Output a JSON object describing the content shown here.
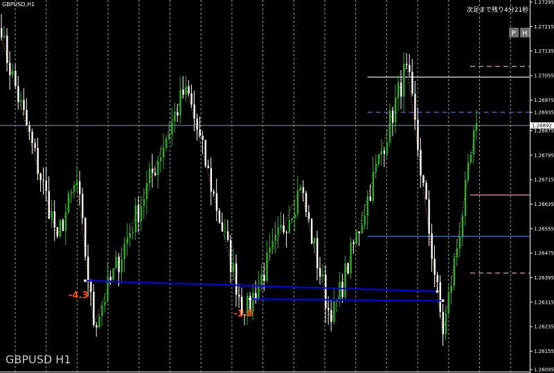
{
  "symbol_label": "GBPUSD,H1",
  "watermark": "GBPUSD H1",
  "timer_text": "次足まで残り4分21秒",
  "buttons": [
    {
      "label": "P"
    },
    {
      "label": "H"
    }
  ],
  "chart_data": {
    "type": "candlestick",
    "title": "",
    "ylim": [
      1.26095,
      1.27295
    ],
    "y_ticks": [
      "1.27295",
      "1.27215",
      "1.27135",
      "1.27055",
      "1.26975",
      "1.26935",
      "1.26875",
      "1.26795",
      "1.26715",
      "1.26635",
      "1.26555",
      "1.26475",
      "1.26395",
      "1.26315",
      "1.26235",
      "1.26155",
      "1.26095"
    ],
    "current_price": 1.26892,
    "current_price_label": "1.26892",
    "colors": {
      "bull": "#22b222",
      "bear": "#ffffff",
      "zigzag": "#b8691e",
      "trendline": "#0000ff",
      "grid": "#b0b0b0"
    },
    "zigzag": [
      {
        "i": 0,
        "p": 1.2718
      },
      {
        "i": 20,
        "p": 1.2653
      },
      {
        "i": 27,
        "p": 1.2671
      },
      {
        "i": 33,
        "p": 1.2624
      },
      {
        "i": 66,
        "p": 1.2702
      },
      {
        "i": 87,
        "p": 1.2627
      },
      {
        "i": 107,
        "p": 1.2669
      },
      {
        "i": 118,
        "p": 1.2625
      },
      {
        "i": 145,
        "p": 1.2709
      },
      {
        "i": 158,
        "p": 1.2621
      },
      {
        "i": 170,
        "p": 1.269
      }
    ],
    "trendlines": [
      {
        "from": {
          "i": 30,
          "p": 1.26385
        },
        "to": {
          "i": 156,
          "p": 1.2635
        }
      },
      {
        "from": {
          "i": 89,
          "p": 1.26325
        },
        "to": {
          "i": 158,
          "p": 1.2632
        }
      }
    ],
    "annotations": [
      {
        "text": "-4.3",
        "i": 28,
        "p": 1.2634,
        "color": "#ff4500"
      },
      {
        "text": "-1.0",
        "i": 87,
        "p": 1.2628,
        "color": "#ff4500"
      }
    ],
    "levels": [
      {
        "p": 1.27085,
        "color": "#e89aa8",
        "style": "dash"
      },
      {
        "p": 1.2705,
        "color": "#ffffff",
        "style": "solid",
        "from_i": 131
      },
      {
        "p": 1.26935,
        "color": "#3b7be0",
        "style": "dash",
        "from_i": 131
      },
      {
        "p": 1.26665,
        "color": "#e89aa8",
        "style": "solid"
      },
      {
        "p": 1.2653,
        "color": "#3b7be0",
        "style": "solid",
        "from_i": 131
      },
      {
        "p": 1.2641,
        "color": "#e89aa8",
        "style": "dash"
      }
    ]
  }
}
